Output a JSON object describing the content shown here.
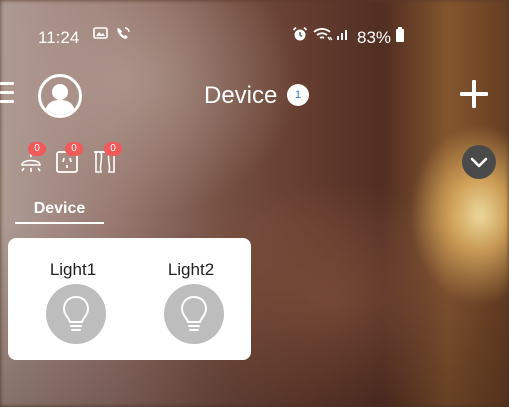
{
  "status_bar": {
    "time": "11:24",
    "battery": "83%",
    "icons": [
      "gallery-icon",
      "phone-call-icon",
      "alarm-icon",
      "wifi-icon",
      "signal-icon",
      "battery-icon"
    ]
  },
  "header": {
    "title": "Device",
    "badge": "1",
    "icons": [
      "menu-icon",
      "profile-icon",
      "plus-icon"
    ]
  },
  "categories": [
    {
      "name": "ceiling-light-icon",
      "count": "0"
    },
    {
      "name": "socket-icon",
      "count": "0"
    },
    {
      "name": "curtain-icon",
      "count": "0"
    }
  ],
  "tabs": [
    {
      "label": "Device",
      "active": true
    }
  ],
  "devices": [
    {
      "name": "Light1",
      "icon": "light-bulb-icon"
    },
    {
      "name": "Light2",
      "icon": "light-bulb-icon"
    }
  ],
  "colors": {
    "badge_red": "#f05a5a",
    "badge_blue_text": "#2a7ec9",
    "device_icon_bg": "#bdbdbd",
    "dropdown_bg": "#4a4a4a"
  }
}
